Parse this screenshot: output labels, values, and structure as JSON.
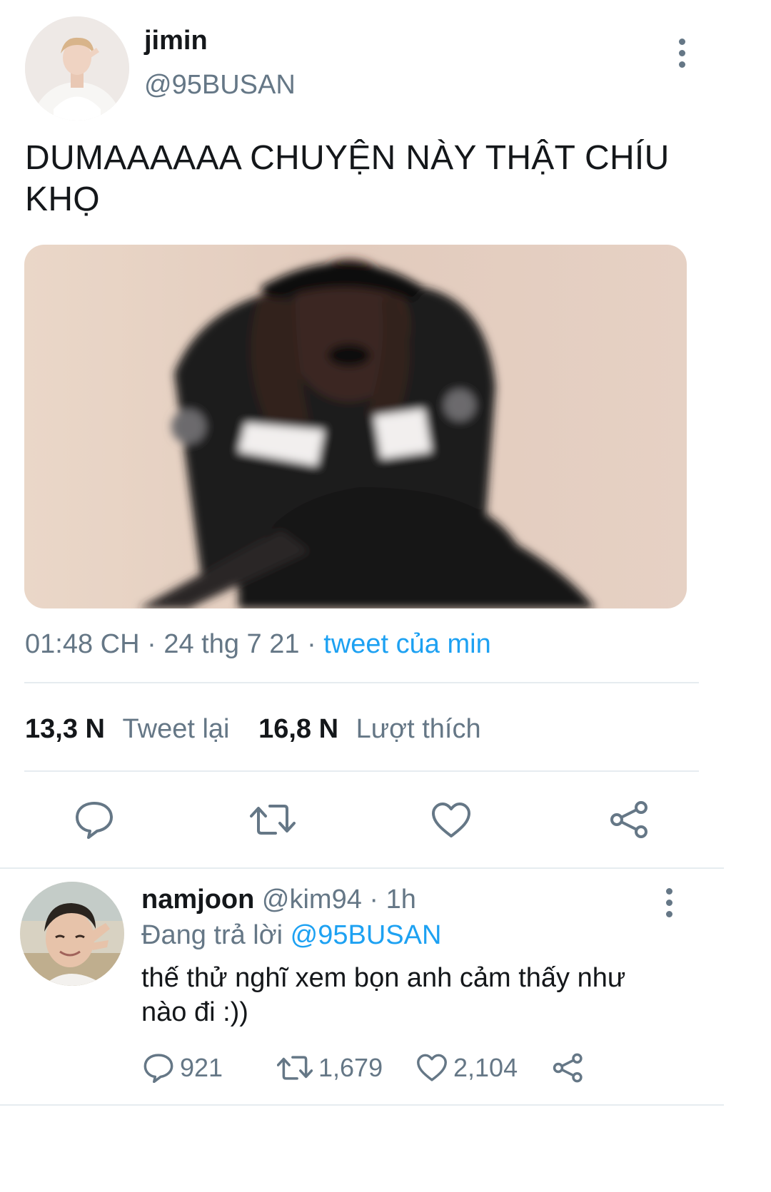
{
  "tweet": {
    "display_name": "jimin",
    "handle": "@95BUSAN",
    "text": "DUMAAAAAA CHUYỆN NÀY THẬT CHÍU KHỌ",
    "time": "01:48 CH",
    "sep1": "·",
    "date": "24 thg 7 21",
    "sep2": "·",
    "source": "tweet của min",
    "retweets_count": "13,3 N",
    "retweets_label": "Tweet lại",
    "likes_count": "16,8 N",
    "likes_label": "Lượt thích",
    "icons": [
      "reply-icon",
      "retweet-icon",
      "like-icon",
      "share-icon"
    ]
  },
  "reply": {
    "display_name": "namjoon",
    "handle": "@kim94",
    "time": "· 1h",
    "replying_prefix": "Đang trả lời",
    "replying_to": "@95BUSAN",
    "text": "thế thử nghĩ xem bọn anh cảm thấy như nào đi :))",
    "reply_count": "921",
    "retweet_count": "1,679",
    "like_count": "2,104"
  },
  "colors": {
    "accent": "#1da1f2",
    "muted": "#657786",
    "text": "#14171a",
    "divider": "#e6ecf0"
  }
}
